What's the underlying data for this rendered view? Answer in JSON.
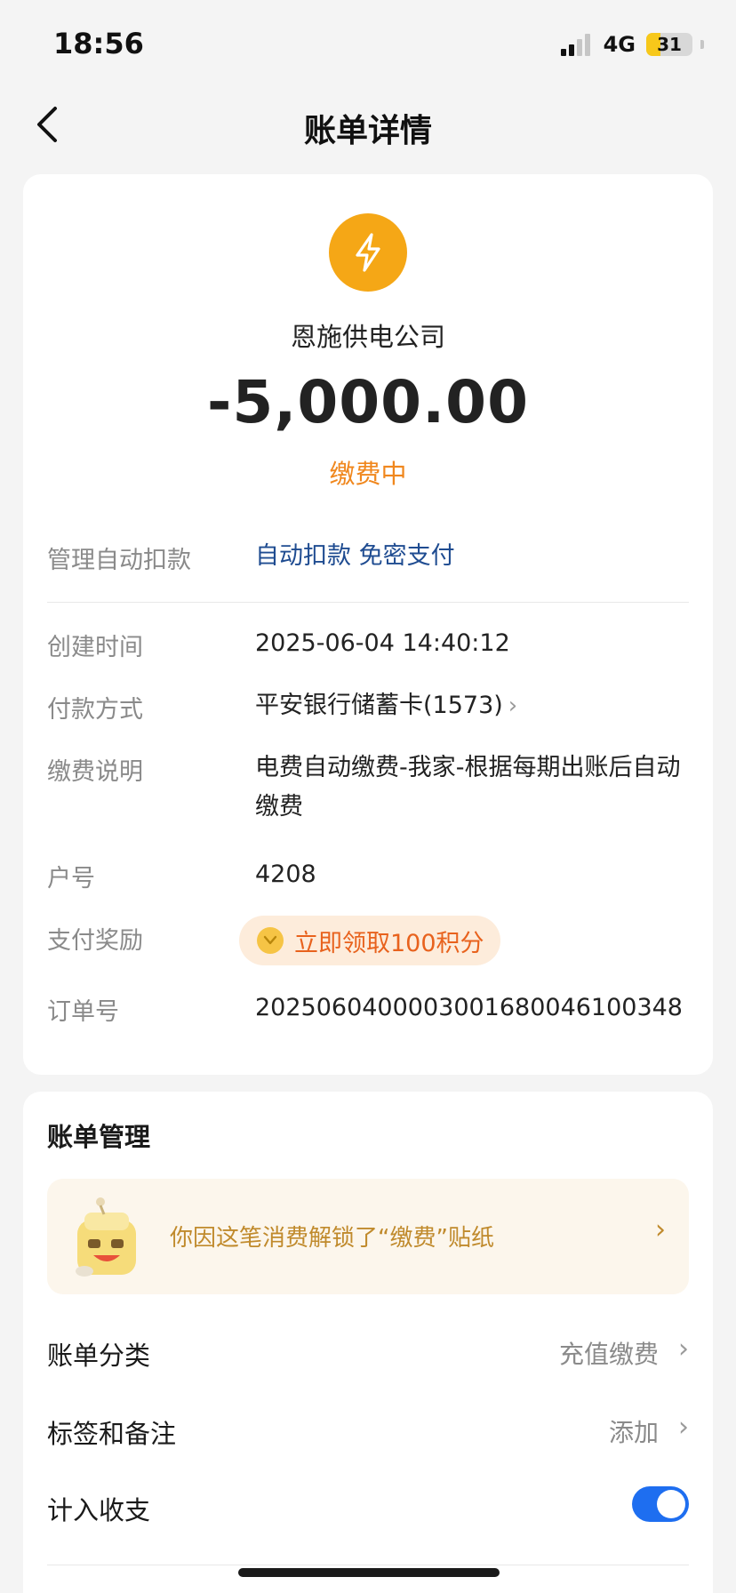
{
  "status_bar": {
    "time": "18:56",
    "network": "4G",
    "battery": "31",
    "battery_level": 0.31
  },
  "nav": {
    "title": "账单详情",
    "back_icon": "chevron-left-icon"
  },
  "bill": {
    "merchant_icon": "lightning-icon",
    "merchant_icon_color": "#f5a716",
    "merchant_name": "恩施供电公司",
    "amount": "-5,000.00",
    "status": "缴费中",
    "status_color": "#f0871d"
  },
  "details": {
    "autopay": {
      "label": "管理自动扣款",
      "value": "自动扣款 免密支付"
    },
    "created": {
      "label": "创建时间",
      "value": "2025-06-04 14:40:12"
    },
    "payment_method": {
      "label": "付款方式",
      "value": "平安银行储蓄卡(1573)"
    },
    "description": {
      "label": "缴费说明",
      "value": "电费自动缴费-我家-根据每期出账后自动缴费"
    },
    "account_no": {
      "label": "户号",
      "value": "4208"
    },
    "reward": {
      "label": "支付奖励",
      "value": "立即领取100积分"
    },
    "order_no": {
      "label": "订单号",
      "value": "2025060400003001680046100348"
    }
  },
  "manage": {
    "title": "账单管理",
    "sticker_text": "你因这笔消费解锁了“缴费”贴纸",
    "category": {
      "label": "账单分类",
      "value": "充值缴费"
    },
    "tags": {
      "label": "标签和备注",
      "value": "添加"
    },
    "include_in_stats": {
      "label": "计入收支",
      "enabled": true
    },
    "toggle_color": "#1e6ef0"
  }
}
